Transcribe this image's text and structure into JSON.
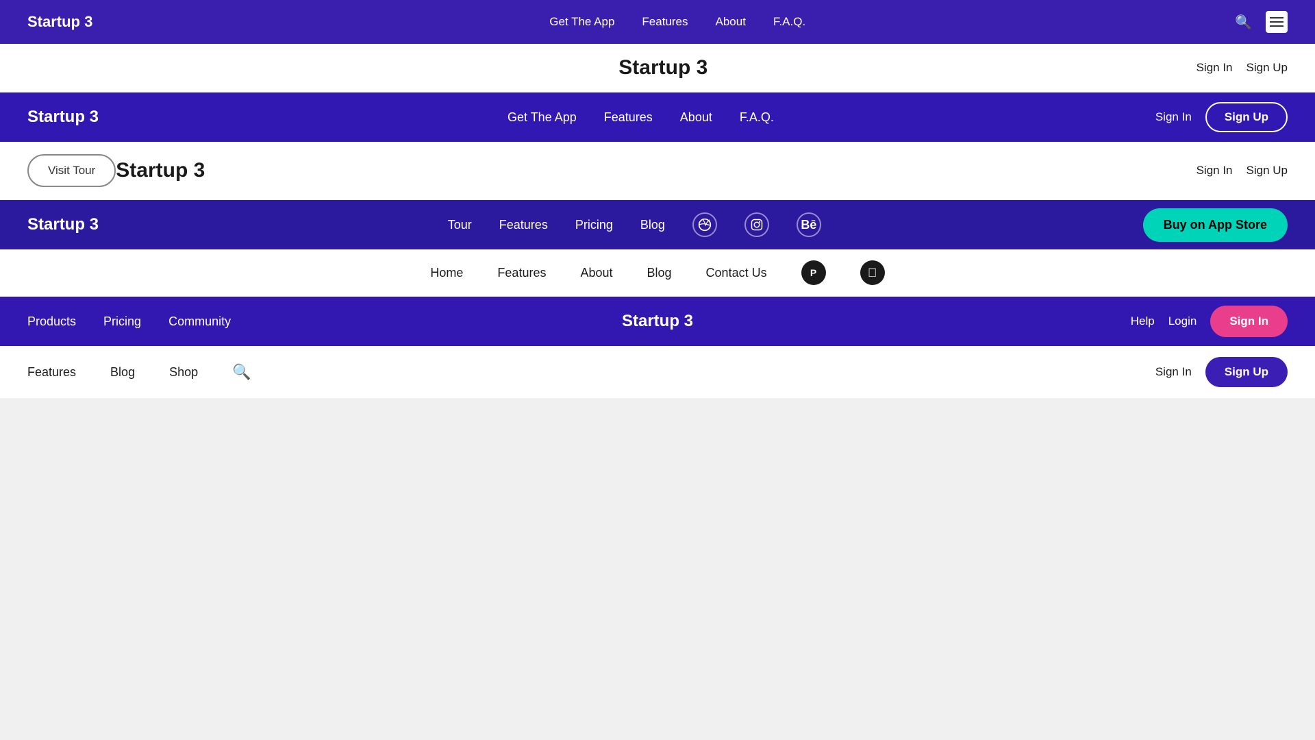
{
  "nav1": {
    "brand": "Startup 3",
    "links": [
      "Get The App",
      "Features",
      "About",
      "F.A.Q."
    ],
    "right": []
  },
  "section1": {
    "title": "Startup 3",
    "left_btn": null,
    "right_items": [
      "Sign In",
      "Sign Up"
    ]
  },
  "nav2": {
    "brand": "Startup 3",
    "links": [
      "Get The App",
      "Features",
      "About",
      "F.A.Q."
    ],
    "sign_in": "Sign In",
    "sign_up": "Sign Up"
  },
  "section2": {
    "title": "Startup 3",
    "left_btn": "Visit Tour",
    "right_items": [
      "Sign In",
      "Sign Up"
    ]
  },
  "nav3": {
    "brand": "Startup 3",
    "links": [
      "Tour",
      "Features",
      "Pricing",
      "Blog"
    ],
    "social": [
      "dribbble",
      "instagram",
      "behance"
    ],
    "cta": "Buy on App Store"
  },
  "section3": {
    "title": null,
    "links": [
      "Home",
      "Features",
      "About",
      "Blog",
      "Contact Us"
    ],
    "social": [
      "product-hunt",
      "apple"
    ]
  },
  "nav4": {
    "brand": "Startup 3",
    "links": [
      "Products",
      "Pricing",
      "Community"
    ],
    "title": "Startup 3",
    "right_items": [
      "Help",
      "Login"
    ],
    "sign_in": "Sign In"
  },
  "section4": {
    "links": [
      "Features",
      "Blog",
      "Shop"
    ],
    "search": true,
    "right_items": [
      "Sign In",
      "Sign Up"
    ]
  },
  "labels": {
    "visit_tour": "Visit Tour",
    "sign_in": "Sign In",
    "sign_up": "Sign Up",
    "buy_app_store": "Buy on App Store",
    "help": "Help",
    "login": "Login",
    "get_the_app": "Get The App",
    "features": "Features",
    "about": "About",
    "faq": "F.A.Q.",
    "tour": "Tour",
    "pricing": "Pricing",
    "blog": "Blog",
    "home": "Home",
    "contact_us": "Contact Us",
    "products": "Products",
    "community": "Community",
    "shop": "Shop",
    "startup3": "Startup 3"
  }
}
